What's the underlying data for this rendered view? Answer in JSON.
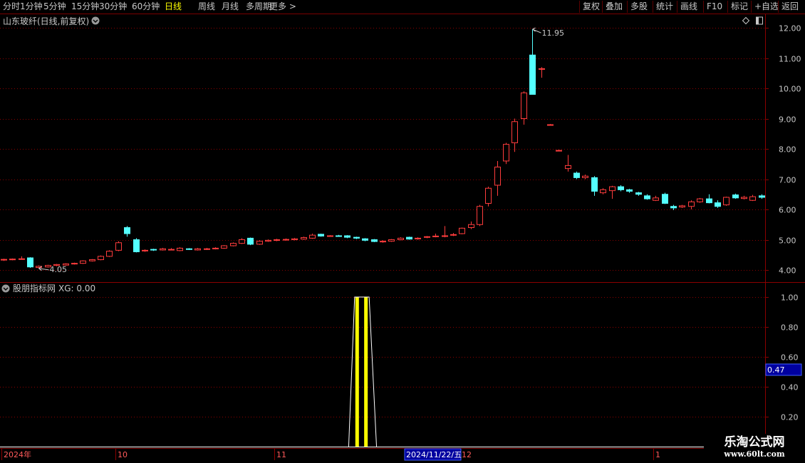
{
  "toolbar": {
    "left": [
      "分时",
      "1分钟",
      "5分钟",
      "15分钟",
      "30分钟",
      "60分钟",
      "日线",
      "周线",
      "月线",
      "多周期",
      "更多 >"
    ],
    "active": "日线",
    "right": [
      "复权",
      "叠加",
      "多股",
      "统计",
      "画线",
      "F10",
      "标记",
      "+自选",
      "返回"
    ]
  },
  "main_panel": {
    "title": "山东玻纤(日线,前复权)",
    "collapse_icon": "chevron-down-icon",
    "corner_icons": [
      "diamond-icon",
      "window-toggle-icon"
    ],
    "high_label": "11.95",
    "low_label": "4.05"
  },
  "indicator_panel": {
    "title": "股朋指标网",
    "formula": "XG: 0.00",
    "collapse_icon": "chevron-down-icon",
    "cursor_value": "0.47"
  },
  "date_axis": {
    "labels": [
      "2024年",
      "10",
      "11",
      "12",
      "1"
    ],
    "cursor_date": "2024/11/22/五"
  },
  "watermark": {
    "brand": "乐淘公式网",
    "site": "www.60lt.com"
  },
  "colors": {
    "up": "#ff3c3c",
    "down": "#54ffff",
    "signal": "#ffff00",
    "grid": "#8b0000",
    "axis_text": "#c8c8c8",
    "cursor_box": "#0000a0"
  },
  "chart_data": [
    {
      "type": "candlestick",
      "title": "山东玻纤(日线,前复权)",
      "y_axis_ticks": [
        "12.00",
        "11.00",
        "10.00",
        "9.00",
        "8.00",
        "7.00",
        "6.00",
        "5.00",
        "4.00"
      ],
      "ylim": [
        3.7,
        12.1
      ],
      "grid": "dotted horizontal",
      "fields": [
        "open",
        "close",
        "high",
        "low"
      ],
      "candles": [
        [
          4.33,
          4.35,
          4.37,
          4.3
        ],
        [
          4.35,
          4.36,
          4.38,
          4.32
        ],
        [
          4.36,
          4.37,
          4.45,
          4.35
        ],
        [
          4.4,
          4.1,
          4.42,
          4.07
        ],
        [
          4.08,
          4.12,
          4.15,
          4.05
        ],
        [
          4.1,
          4.15,
          4.17,
          4.08
        ],
        [
          4.15,
          4.18,
          4.2,
          4.12
        ],
        [
          4.16,
          4.2,
          4.22,
          4.14
        ],
        [
          4.2,
          4.22,
          4.24,
          4.18
        ],
        [
          4.22,
          4.3,
          4.32,
          4.2
        ],
        [
          4.3,
          4.34,
          4.36,
          4.28
        ],
        [
          4.34,
          4.45,
          4.48,
          4.32
        ],
        [
          4.45,
          4.62,
          4.65,
          4.43
        ],
        [
          4.65,
          4.9,
          4.95,
          4.62
        ],
        [
          5.4,
          5.2,
          5.45,
          5.1
        ],
        [
          5.0,
          4.6,
          5.05,
          4.58
        ],
        [
          4.63,
          4.65,
          4.68,
          4.6
        ],
        [
          4.68,
          4.66,
          4.7,
          4.63
        ],
        [
          4.66,
          4.7,
          4.73,
          4.64
        ],
        [
          4.68,
          4.68,
          4.72,
          4.65
        ],
        [
          4.64,
          4.72,
          4.75,
          4.62
        ],
        [
          4.7,
          4.68,
          4.72,
          4.66
        ],
        [
          4.66,
          4.7,
          4.73,
          4.64
        ],
        [
          4.68,
          4.7,
          4.73,
          4.66
        ],
        [
          4.7,
          4.72,
          4.75,
          4.68
        ],
        [
          4.72,
          4.8,
          4.82,
          4.7
        ],
        [
          4.8,
          4.88,
          4.91,
          4.78
        ],
        [
          4.88,
          5.0,
          5.05,
          4.86
        ],
        [
          5.05,
          4.85,
          5.07,
          4.82
        ],
        [
          4.85,
          4.95,
          4.98,
          4.83
        ],
        [
          4.95,
          4.98,
          5.01,
          4.93
        ],
        [
          4.98,
          5.0,
          5.03,
          4.95
        ],
        [
          5.0,
          5.01,
          5.04,
          4.97
        ],
        [
          5.0,
          5.03,
          5.06,
          4.98
        ],
        [
          5.02,
          5.07,
          5.1,
          5.0
        ],
        [
          5.05,
          5.15,
          5.2,
          5.03
        ],
        [
          5.18,
          5.12,
          5.2,
          5.1
        ],
        [
          5.12,
          5.13,
          5.15,
          5.1
        ],
        [
          5.13,
          5.12,
          5.16,
          5.1
        ],
        [
          5.13,
          5.08,
          5.15,
          5.05
        ],
        [
          5.08,
          5.05,
          5.1,
          5.02
        ],
        [
          5.03,
          4.98,
          5.05,
          4.95
        ],
        [
          5.0,
          4.94,
          5.02,
          4.92
        ],
        [
          4.93,
          4.95,
          4.98,
          4.9
        ],
        [
          4.95,
          5.0,
          5.02,
          4.93
        ],
        [
          5.0,
          5.05,
          5.08,
          4.98
        ],
        [
          5.08,
          5.02,
          5.1,
          5.0
        ],
        [
          5.03,
          5.05,
          5.08,
          5.0
        ],
        [
          5.08,
          5.1,
          5.12,
          5.05
        ],
        [
          5.1,
          5.12,
          5.2,
          5.08
        ],
        [
          5.12,
          5.13,
          5.45,
          5.08
        ],
        [
          5.15,
          5.17,
          5.22,
          5.12
        ],
        [
          5.2,
          5.38,
          5.4,
          5.18
        ],
        [
          5.4,
          5.5,
          5.6,
          5.35
        ],
        [
          5.5,
          6.1,
          6.15,
          5.45
        ],
        [
          6.2,
          6.7,
          6.75,
          6.1
        ],
        [
          6.8,
          7.4,
          7.6,
          6.45
        ],
        [
          7.6,
          8.15,
          8.2,
          7.5
        ],
        [
          8.2,
          8.9,
          9.0,
          7.9
        ],
        [
          9.0,
          9.85,
          9.9,
          8.8
        ],
        [
          11.1,
          9.8,
          11.95,
          9.8
        ],
        [
          10.65,
          10.65,
          10.7,
          10.35
        ],
        [
          8.8,
          8.8,
          8.82,
          8.78
        ],
        [
          7.95,
          7.95,
          7.97,
          7.93
        ],
        [
          7.35,
          7.45,
          7.8,
          7.25
        ],
        [
          7.2,
          7.05,
          7.25,
          7.0
        ],
        [
          7.05,
          7.1,
          7.15,
          7.0
        ],
        [
          7.05,
          6.6,
          7.1,
          6.45
        ],
        [
          6.55,
          6.65,
          6.7,
          6.5
        ],
        [
          6.62,
          6.75,
          6.78,
          6.35
        ],
        [
          6.75,
          6.65,
          6.8,
          6.6
        ],
        [
          6.65,
          6.6,
          6.68,
          6.55
        ],
        [
          6.55,
          6.5,
          6.58,
          6.45
        ],
        [
          6.45,
          6.35,
          6.5,
          6.32
        ],
        [
          6.3,
          6.38,
          6.45,
          6.28
        ],
        [
          6.5,
          6.2,
          6.55,
          6.18
        ],
        [
          6.1,
          6.05,
          6.15,
          5.98
        ],
        [
          6.08,
          6.12,
          6.15,
          6.05
        ],
        [
          6.1,
          6.25,
          6.3,
          6.0
        ],
        [
          6.25,
          6.35,
          6.38,
          6.22
        ],
        [
          6.35,
          6.22,
          6.5,
          6.2
        ],
        [
          6.22,
          6.1,
          6.3,
          6.05
        ],
        [
          6.15,
          6.4,
          6.42,
          6.12
        ],
        [
          6.48,
          6.38,
          6.52,
          6.35
        ],
        [
          6.36,
          6.4,
          6.45,
          6.33
        ],
        [
          6.3,
          6.42,
          6.48,
          6.28
        ],
        [
          6.45,
          6.4,
          6.5,
          6.35
        ]
      ]
    },
    {
      "type": "line",
      "title": "股朋指标网",
      "series": [
        {
          "name": "XG",
          "values_by_candle_index": {
            "39": 0,
            "40": 1,
            "41": 1,
            "42": 0
          }
        }
      ],
      "baseline": 0,
      "y_axis_ticks": [
        "1.00",
        "0.80",
        "0.60",
        "0.40",
        "0.20"
      ],
      "ylim": [
        0,
        1.0
      ]
    }
  ]
}
